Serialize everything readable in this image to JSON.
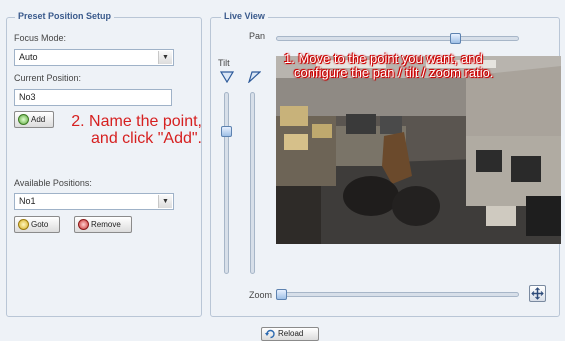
{
  "preset_setup": {
    "legend": "Preset Position Setup",
    "focus_mode_label": "Focus Mode:",
    "focus_mode_value": "Auto",
    "current_position_label": "Current Position:",
    "current_position_value": "No3",
    "add_label": "Add",
    "available_positions_label": "Available Positions:",
    "available_positions_value": "No1",
    "goto_label": "Goto",
    "remove_label": "Remove"
  },
  "live_view": {
    "legend": "Live View",
    "pan_label": "Pan",
    "tilt_label": "Tilt",
    "zoom_label": "Zoom",
    "pan_level": 0.75,
    "tilt_level": 0.2,
    "zoom_level": 0.0
  },
  "annotations": {
    "step1_line1": "1. Move to the point  you want, and",
    "step1_line2": "configure the pan / tilt / zoom ratio.",
    "step2_line1": "2. Name the point,",
    "step2_line2": "and click \"Add\"."
  },
  "footer": {
    "reload_label": "Reload"
  },
  "icons": {
    "add": "plus-circle-icon",
    "goto": "goto-icon",
    "remove": "remove-icon",
    "reload": "reload-icon",
    "zoom_fit": "zoom-fit-icon",
    "tilt_left": "tilt-left-icon",
    "tilt_right": "tilt-right-icon"
  },
  "colors": {
    "annotation": "#d62020",
    "legend": "#3a5a8c"
  }
}
